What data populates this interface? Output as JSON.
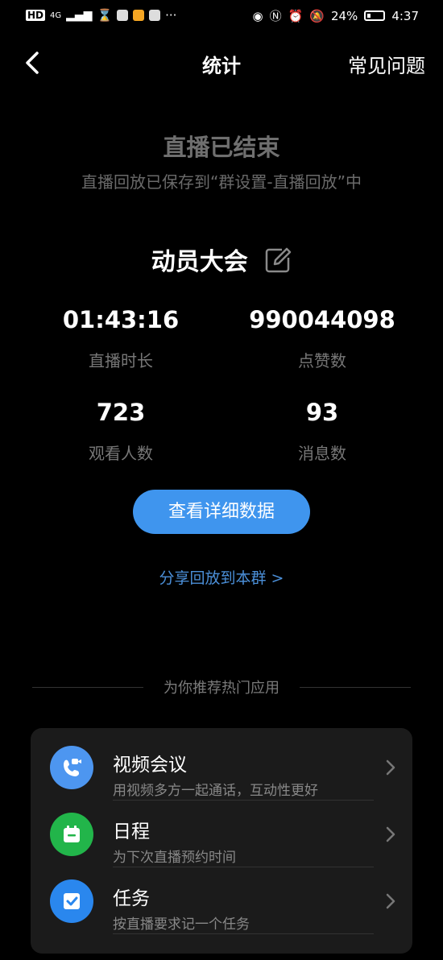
{
  "status_bar": {
    "left_label": "HD",
    "network": "4G",
    "battery": "24%",
    "time": "4:37"
  },
  "nav": {
    "title": "统计",
    "faq": "常见问题"
  },
  "live_end": {
    "title": "直播已结束",
    "subtitle": "直播回放已保存到“群设置-直播回放”中"
  },
  "meeting_name": "动员大会",
  "stats": [
    {
      "value": "01:43:16",
      "label": "直播时长"
    },
    {
      "value": "990044098",
      "label": "点赞数"
    },
    {
      "value": "723",
      "label": "观看人数"
    },
    {
      "value": "93",
      "label": "消息数"
    }
  ],
  "detail_button": "查看详细数据",
  "share_link": "分享回放到本群 >",
  "recommend_title": "为你推荐热门应用",
  "apps": [
    {
      "title": "视频会议",
      "desc": "用视频多方一起通话，互动性更好",
      "icon": "video-call-icon",
      "color": "#4d96f0"
    },
    {
      "title": "日程",
      "desc": "为下次直播预约时间",
      "icon": "calendar-icon",
      "color": "#22b54a"
    },
    {
      "title": "任务",
      "desc": "按直播要求记一个任务",
      "icon": "task-check-icon",
      "color": "#2a87ee"
    }
  ]
}
